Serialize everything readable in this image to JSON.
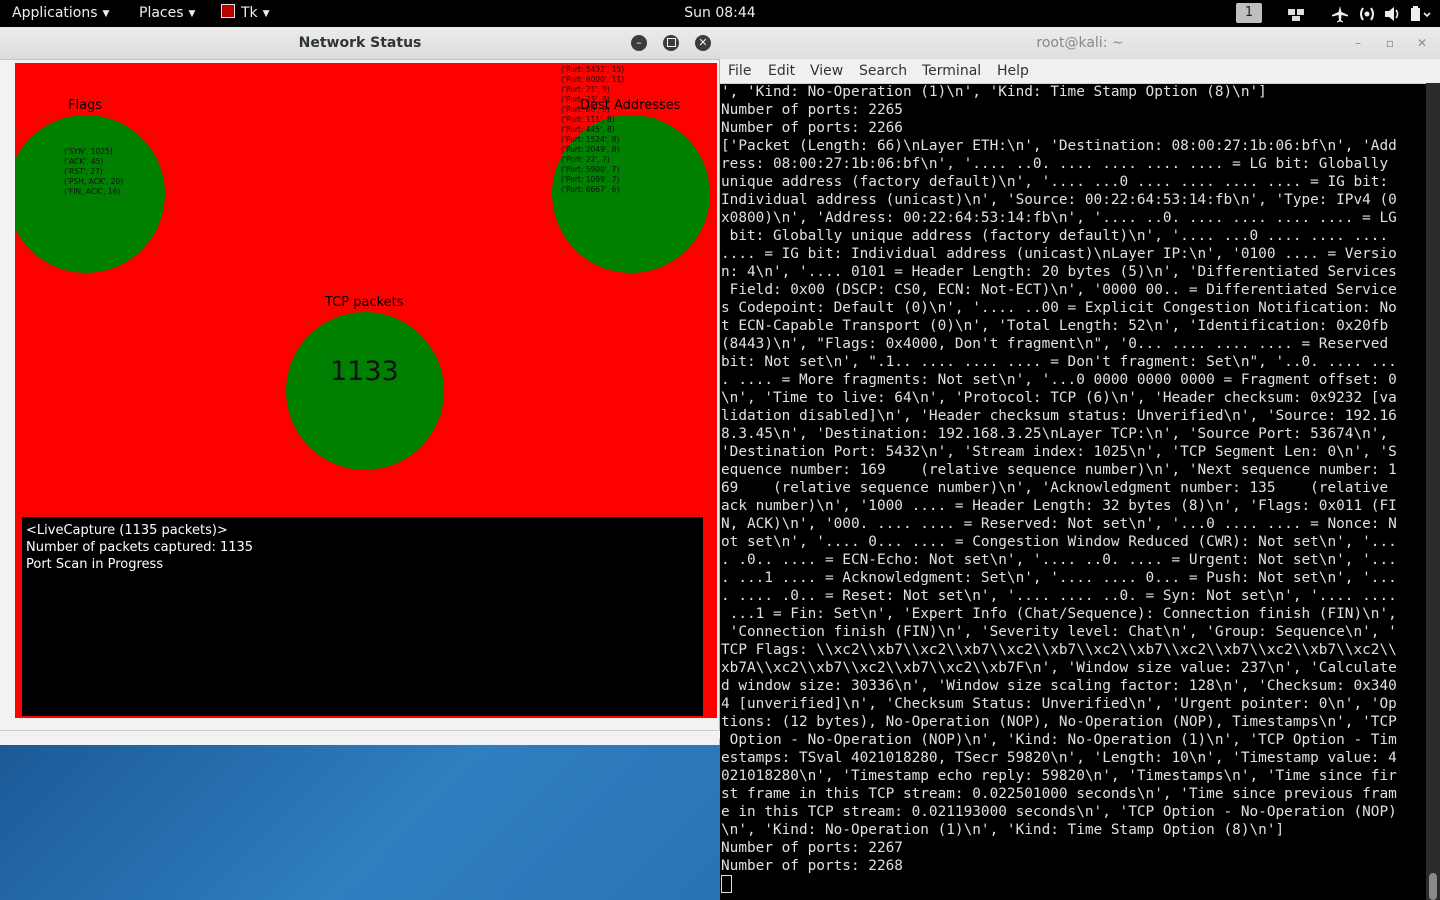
{
  "topbar": {
    "applications": "Applications",
    "places": "Places",
    "tk_app": "Tk",
    "clock": "Sun 08:44",
    "workspace": "1"
  },
  "tk_window": {
    "title": "Network Status",
    "flags": {
      "label": "Flags",
      "entries": [
        "('SYN', 1025)",
        "('ACK', 45)",
        "('RST', 27)",
        "('PSH, ACK', 20)",
        "('FIN, ACK', 16)"
      ]
    },
    "dest": {
      "label": "Dest Addresses",
      "entries": [
        "('Port: 5432', 15)",
        "('Port: 6000', 11)",
        "('Port: 21', 9)",
        "('Port: 23', 9)",
        "('Port: 80', 9)",
        "('Port: 111', 8)",
        "('Port: 445', 8)",
        "('Port: 1524', 8)",
        "('Port: 2049', 8)",
        "('Port: 22', 7)",
        "('Port: 5900', 7)",
        "('Port: 1099', 7)",
        "('Port: 6667', 6)"
      ]
    },
    "tcp": {
      "label": "TCP packets",
      "count": "1133"
    },
    "console": [
      "<LiveCapture (1135 packets)>",
      "Number of packets captured: 1135",
      "Port Scan in Progress"
    ]
  },
  "terminal": {
    "title": "root@kali: ~",
    "menu": [
      "File",
      "Edit",
      "View",
      "Search",
      "Terminal",
      "Help"
    ],
    "lines": [
      "', 'Kind: No-Operation (1)\\n', 'Kind: Time Stamp Option (8)\\n']",
      "Number of ports: 2265",
      "Number of ports: 2266",
      "['Packet (Length: 66)\\nLayer ETH:\\n', 'Destination: 08:00:27:1b:06:bf\\n', 'Add",
      "ress: 08:00:27:1b:06:bf\\n', '.... ..0. .... .... .... .... = LG bit: Globally",
      "unique address (factory default)\\n', '.... ...0 .... .... .... .... = IG bit:",
      "Individual address (unicast)\\n', 'Source: 00:22:64:53:14:fb\\n', 'Type: IPv4 (0",
      "x0800)\\n', 'Address: 00:22:64:53:14:fb\\n', '.... ..0. .... .... .... .... = LG",
      " bit: Globally unique address (factory default)\\n', '.... ...0 .... .... ....",
      ".... = IG bit: Individual address (unicast)\\nLayer IP:\\n', '0100 .... = Versio",
      "n: 4\\n', '.... 0101 = Header Length: 20 bytes (5)\\n', 'Differentiated Services",
      " Field: 0x00 (DSCP: CS0, ECN: Not-ECT)\\n', '0000 00.. = Differentiated Service",
      "s Codepoint: Default (0)\\n', '.... ..00 = Explicit Congestion Notification: No",
      "t ECN-Capable Transport (0)\\n', 'Total Length: 52\\n', 'Identification: 0x20fb",
      "(8443)\\n', \"Flags: 0x4000, Don't fragment\\n\", '0... .... .... .... = Reserved",
      "bit: Not set\\n', \".1.. .... .... .... = Don't fragment: Set\\n\", '..0. .... ...",
      ". .... = More fragments: Not set\\n', '...0 0000 0000 0000 = Fragment offset: 0",
      "\\n', 'Time to live: 64\\n', 'Protocol: TCP (6)\\n', 'Header checksum: 0x9232 [va",
      "lidation disabled]\\n', 'Header checksum status: Unverified\\n', 'Source: 192.16",
      "8.3.45\\n', 'Destination: 192.168.3.25\\nLayer TCP:\\n', 'Source Port: 53674\\n',",
      "'Destination Port: 5432\\n', 'Stream index: 1025\\n', 'TCP Segment Len: 0\\n', 'S",
      "equence number: 169    (relative sequence number)\\n', 'Next sequence number: 1",
      "69    (relative sequence number)\\n', 'Acknowledgment number: 135    (relative",
      "ack number)\\n', '1000 .... = Header Length: 32 bytes (8)\\n', 'Flags: 0x011 (FI",
      "N, ACK)\\n', '000. .... .... = Reserved: Not set\\n', '...0 .... .... = Nonce: N",
      "ot set\\n', '.... 0... .... = Congestion Window Reduced (CWR): Not set\\n', '...",
      ". .0.. .... = ECN-Echo: Not set\\n', '.... ..0. .... = Urgent: Not set\\n', '...",
      ". ...1 .... = Acknowledgment: Set\\n', '.... .... 0... = Push: Not set\\n', '...",
      ". .... .0.. = Reset: Not set\\n', '.... .... ..0. = Syn: Not set\\n', '.... ....",
      " ...1 = Fin: Set\\n', 'Expert Info (Chat/Sequence): Connection finish (FIN)\\n',",
      " 'Connection finish (FIN)\\n', 'Severity level: Chat\\n', 'Group: Sequence\\n', '",
      "TCP Flags: \\\\xc2\\\\xb7\\\\xc2\\\\xb7\\\\xc2\\\\xb7\\\\xc2\\\\xb7\\\\xc2\\\\xb7\\\\xc2\\\\xb7\\\\xc2\\\\",
      "xb7A\\\\xc2\\\\xb7\\\\xc2\\\\xb7\\\\xc2\\\\xb7F\\n', 'Window size value: 237\\n', 'Calculate",
      "d window size: 30336\\n', 'Window size scaling factor: 128\\n', 'Checksum: 0x340",
      "4 [unverified]\\n', 'Checksum Status: Unverified\\n', 'Urgent pointer: 0\\n', 'Op",
      "tions: (12 bytes), No-Operation (NOP), No-Operation (NOP), Timestamps\\n', 'TCP",
      " Option - No-Operation (NOP)\\n', 'Kind: No-Operation (1)\\n', 'TCP Option - Tim",
      "estamps: TSval 4021018280, TSecr 59820\\n', 'Length: 10\\n', 'Timestamp value: 4",
      "021018280\\n', 'Timestamp echo reply: 59820\\n', 'Timestamps\\n', 'Time since fir",
      "st frame in this TCP stream: 0.022501000 seconds\\n', 'Time since previous fram",
      "e in this TCP stream: 0.021193000 seconds\\n', 'TCP Option - No-Operation (NOP)",
      "\\n', 'Kind: No-Operation (1)\\n', 'Kind: Time Stamp Option (8)\\n']",
      "Number of ports: 2267",
      "Number of ports: 2268"
    ]
  },
  "colors": {
    "canvas_bg": "#ff0000",
    "circle_fill": "#008000",
    "terminal_bg": "#000000"
  }
}
